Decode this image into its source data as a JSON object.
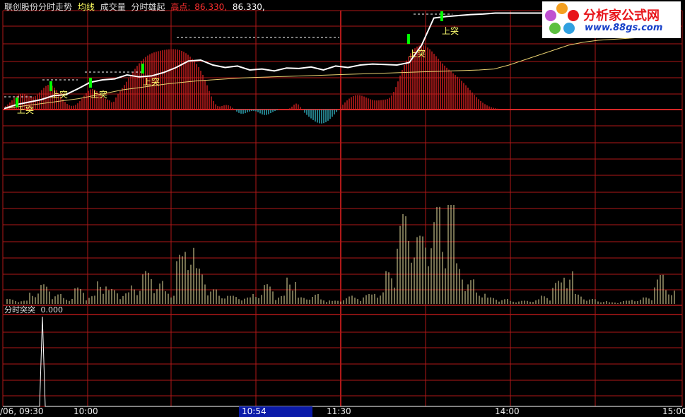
{
  "header": {
    "stock_title": "联创股份分时走势",
    "avg_label": "均线",
    "vol_label": "成交量",
    "indicator_label": "分时雄起",
    "high_label": "高点:",
    "high_value1": "86.330,",
    "high_value2": "86.330,"
  },
  "lower_panel": {
    "title": "分时突突",
    "value": "0.000"
  },
  "time_axis": {
    "start": "/06, 09:30",
    "t1": "10:00",
    "cursor": "10:54",
    "t2": "11:30",
    "t3": "14:00",
    "t4": "15:00"
  },
  "logo": {
    "name": "分析家公式网",
    "url": "www.88gs.com"
  },
  "signal_label": "上突",
  "colors": {
    "grid": "#b01818",
    "price": "#ffffff",
    "avg": "#e8d070",
    "vol": "#e8e0a0",
    "bar_pos": "#d02020",
    "bar_neg": "#30b0c0",
    "signal": "#00ff00"
  },
  "chart_data": {
    "type": "line",
    "title": "联创股份分时走势",
    "x_labels": [
      "09:30",
      "10:00",
      "10:54",
      "11:30",
      "14:00",
      "15:00"
    ],
    "high": 86.33,
    "series": [
      {
        "name": "分时走势",
        "values": [
          0.02,
          0.1,
          0.15,
          0.2,
          0.28,
          0.3,
          0.42,
          0.55,
          0.6,
          0.62,
          0.7,
          0.66,
          0.68,
          0.75,
          0.85,
          0.98,
          1.0,
          0.9,
          0.85,
          0.88,
          0.8,
          0.82,
          0.78,
          0.84,
          0.83,
          0.86,
          0.8,
          0.88,
          0.85,
          0.9,
          0.92,
          0.91,
          0.9,
          0.95,
          1.3,
          1.85,
          1.88,
          1.9,
          1.92,
          1.93,
          1.95,
          1.95,
          1.95,
          1.95,
          1.95
        ]
      },
      {
        "name": "均线",
        "values": [
          0.02,
          0.06,
          0.1,
          0.14,
          0.18,
          0.22,
          0.28,
          0.34,
          0.4,
          0.44,
          0.48,
          0.52,
          0.55,
          0.58,
          0.6,
          0.62,
          0.64,
          0.65,
          0.66,
          0.67,
          0.68,
          0.69,
          0.7,
          0.71,
          0.72,
          0.73,
          0.74,
          0.75,
          0.76,
          0.77,
          0.78,
          0.79,
          0.8,
          0.82,
          0.9,
          1.0,
          1.1,
          1.2,
          1.3,
          1.36,
          1.4,
          1.42,
          1.44,
          1.46,
          1.48
        ]
      },
      {
        "name": "成交量",
        "values": [
          3,
          2,
          8,
          12,
          6,
          4,
          10,
          5,
          15,
          9,
          7,
          12,
          20,
          14,
          8,
          30,
          40,
          22,
          9,
          6,
          5,
          4,
          7,
          12,
          5,
          18,
          4,
          6,
          3,
          2,
          5,
          4,
          6,
          8,
          20,
          55,
          48,
          42,
          60,
          38,
          25,
          15,
          8,
          4,
          3,
          2,
          2,
          3,
          5,
          14,
          22,
          6,
          3,
          2,
          1,
          2,
          3,
          4,
          18,
          10
        ]
      },
      {
        "name": "分时突突",
        "values": [
          0,
          0,
          0,
          0,
          0,
          0,
          0,
          0,
          0,
          0,
          0,
          0,
          1,
          0,
          0,
          0,
          0,
          0,
          0,
          0,
          0,
          0,
          0,
          0,
          0,
          0,
          0,
          0,
          0,
          0
        ]
      }
    ],
    "signals": [
      "上突",
      "上突",
      "上突",
      "上突",
      "上突",
      "上突",
      "上突"
    ]
  }
}
